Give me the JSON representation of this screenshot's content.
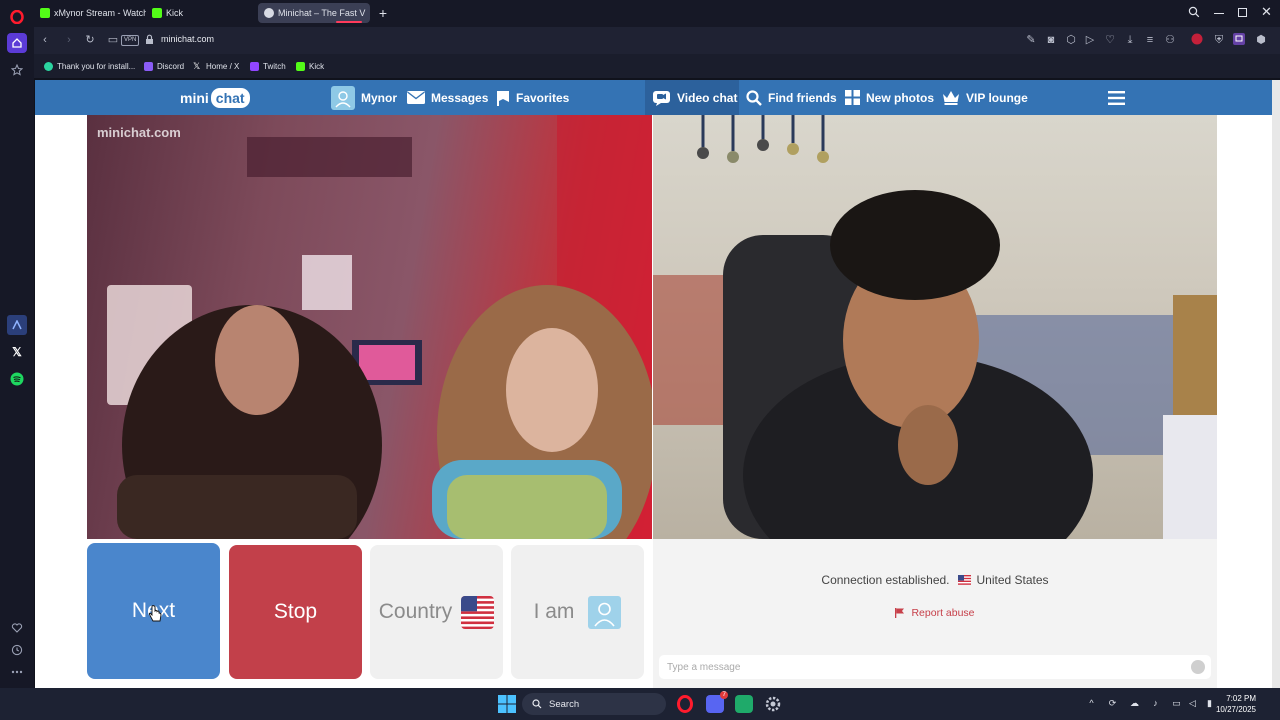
{
  "browser": {
    "tabs": [
      {
        "label": "xMynor Stream - Watch Li",
        "active": false
      },
      {
        "label": "Kick",
        "active": false
      },
      {
        "label": "Minichat – The Fast V",
        "active": true
      }
    ],
    "new_tab_label": "+",
    "url": "minichat.com",
    "vpn_label": "VPN",
    "bookmarks": [
      "Thank you for install...",
      "Discord",
      "Home / X",
      "Twitch",
      "Kick"
    ]
  },
  "site": {
    "logo_left": "mini",
    "logo_right": "chat",
    "user_name": "Mynor",
    "nav": {
      "messages": "Messages",
      "favorites": "Favorites",
      "video_chat": "Video chat",
      "find_friends": "Find friends",
      "new_photos": "New photos",
      "vip_lounge": "VIP lounge"
    },
    "watermark": "minichat.com",
    "controls": {
      "next": "Next",
      "stop": "Stop",
      "country": "Country",
      "i_am": "I am"
    },
    "chat": {
      "status": "Connection established.",
      "country": "United States",
      "report": "Report abuse",
      "placeholder": "Type a message"
    }
  },
  "taskbar": {
    "search": "Search",
    "time": "7:02 PM",
    "date": "10/27/2025",
    "discord_badge": "7"
  },
  "colors": {
    "site_nav": "#3473b4",
    "next_button": "#4a86cc",
    "stop_button": "#c2404a",
    "report": "#c7404a"
  }
}
